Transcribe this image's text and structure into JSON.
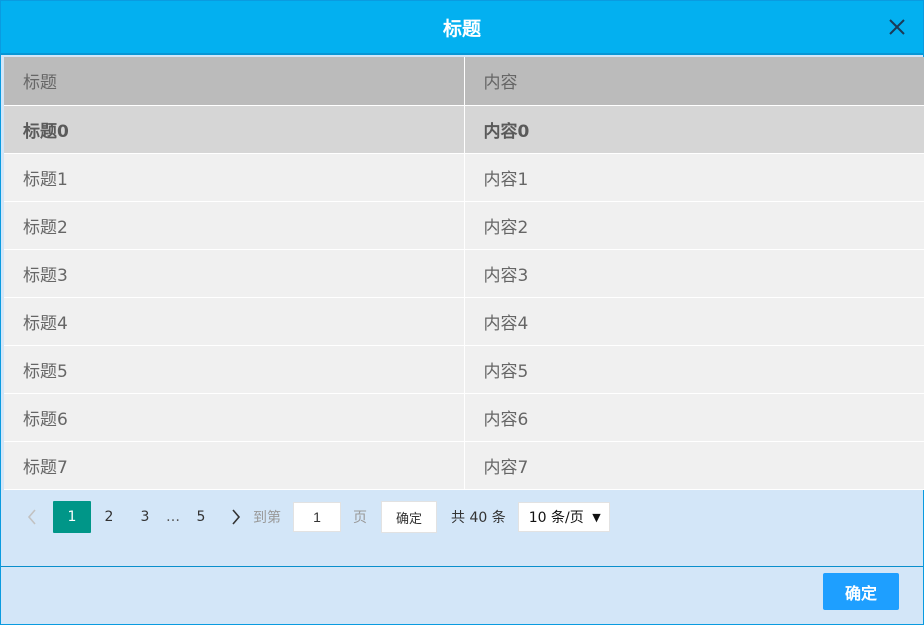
{
  "dialog": {
    "title": "标题",
    "ok_label": "确定"
  },
  "table": {
    "headers": [
      "标题",
      "内容"
    ],
    "rows": [
      [
        "标题0",
        "内容0"
      ],
      [
        "标题1",
        "内容1"
      ],
      [
        "标题2",
        "内容2"
      ],
      [
        "标题3",
        "内容3"
      ],
      [
        "标题4",
        "内容4"
      ],
      [
        "标题5",
        "内容5"
      ],
      [
        "标题6",
        "内容6"
      ],
      [
        "标题7",
        "内容7"
      ]
    ],
    "selected_row": 0
  },
  "pagination": {
    "pages": [
      "1",
      "2",
      "3",
      "…",
      "5"
    ],
    "current": "1",
    "goto_prefix": "到第",
    "goto_value": "1",
    "goto_suffix": "页",
    "goto_button": "确定",
    "total_text": "共 40 条",
    "page_size": "10 条/页"
  },
  "colors": {
    "header_bg": "#03b0f0",
    "accent_green": "#009688",
    "ok_button": "#1e9fff"
  }
}
